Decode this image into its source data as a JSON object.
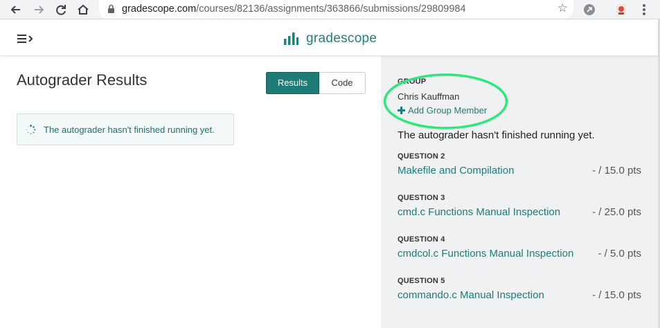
{
  "browser": {
    "url_host": "gradescope.com",
    "url_path": "/courses/82136/assignments/363866/submissions/29809984",
    "icons": [
      "back-icon",
      "forward-icon",
      "reload-icon",
      "home-icon",
      "lock-icon",
      "bookmark-star-icon",
      "extension-icon",
      "profile-extension-icon",
      "menu-dots-icon"
    ]
  },
  "header": {
    "logo_text": "gradescope",
    "brand_color": "#1f807a"
  },
  "left": {
    "title": "Autograder Results",
    "tabs": [
      {
        "label": "Results",
        "active": true
      },
      {
        "label": "Code",
        "active": false
      }
    ],
    "status_message": "The autograder hasn't finished running yet."
  },
  "right": {
    "group_label": "GROUP",
    "member_name": "Chris Kauffman",
    "add_member_label": "Add Group Member",
    "summary": "The autograder hasn't finished running yet.",
    "questions": [
      {
        "label": "QUESTION 2",
        "title": "Makefile and Compilation",
        "points": "- / 15.0 pts"
      },
      {
        "label": "QUESTION 3",
        "title": "cmd.c Functions Manual Inspection",
        "points": "- / 25.0 pts"
      },
      {
        "label": "QUESTION 4",
        "title": "cmdcol.c Functions Manual Inspection",
        "points": "- / 5.0 pts"
      },
      {
        "label": "QUESTION 5",
        "title": "commando.c Manual Inspection",
        "points": "- / 15.0 pts"
      }
    ]
  },
  "colors": {
    "accent": "#1f7b75",
    "highlight": "#2ee879",
    "panel_bg": "#f0f1f2"
  }
}
